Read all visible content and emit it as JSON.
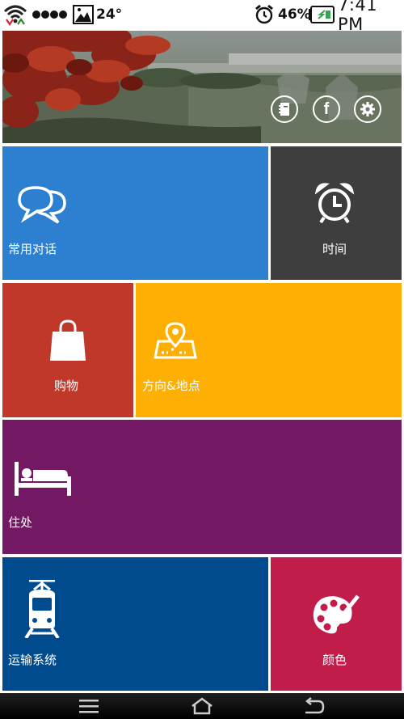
{
  "status_bar": {
    "temperature": "24°",
    "battery_percent": "46%",
    "time": "7:41 PM",
    "icons": [
      "wifi-icon",
      "signal-dots-icon",
      "image-icon",
      "alarm-icon",
      "battery-charging-icon"
    ]
  },
  "banner": {
    "buttons": [
      {
        "name": "notebook-icon"
      },
      {
        "name": "facebook-icon",
        "glyph": "f"
      },
      {
        "name": "settings-icon"
      }
    ]
  },
  "tiles": [
    {
      "id": "conversation",
      "label": "常用对话",
      "color": "#2d7fd0",
      "icon": "chat-bubbles-icon"
    },
    {
      "id": "time",
      "label": "时间",
      "color": "#3e3e3e",
      "icon": "alarm-clock-icon"
    },
    {
      "id": "shopping",
      "label": "购物",
      "color": "#c0382a",
      "icon": "shopping-bag-icon"
    },
    {
      "id": "directions",
      "label": "方向&地点",
      "color": "#fdb003",
      "icon": "map-pin-icon"
    },
    {
      "id": "lodging",
      "label": "住处",
      "color": "#731862",
      "icon": "bed-icon"
    },
    {
      "id": "transport",
      "label": "运输系统",
      "color": "#004b8d",
      "icon": "tram-icon"
    },
    {
      "id": "colors",
      "label": "颜色",
      "color": "#c21c4b",
      "icon": "palette-icon"
    }
  ],
  "nav_bar": {
    "buttons": [
      "menu-icon",
      "home-icon",
      "back-icon"
    ]
  }
}
